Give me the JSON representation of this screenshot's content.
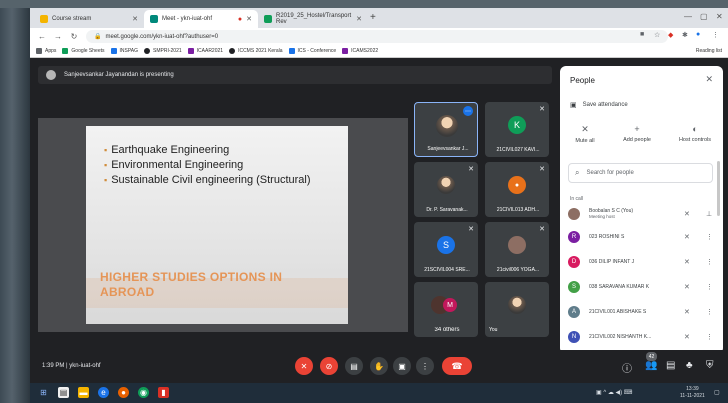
{
  "browser": {
    "tabs": [
      {
        "label": "Course stream",
        "color": "#f4b400"
      },
      {
        "label": "Meet - ykn-iuat-ohf",
        "color": "#00897b"
      },
      {
        "label": "R2019_25_Hostel/Transport Rev",
        "color": "#0f9d58"
      }
    ],
    "url": "meet.google.com/ykn-iuat-ohf?authuser=0",
    "bookmarks": [
      {
        "label": "Apps",
        "color": "#5f6368"
      },
      {
        "label": "Google Sheets",
        "color": "#0f9d58"
      },
      {
        "label": "INSPAG",
        "color": "#1a73e8"
      },
      {
        "label": "SMPRI-2021",
        "color": "#202124"
      },
      {
        "label": "ICAAR2021",
        "color": "#7b1fa2"
      },
      {
        "label": "ICCMS 2021 Kerala",
        "color": "#202124"
      },
      {
        "label": "ICS - Conference",
        "color": "#1a73e8"
      },
      {
        "label": "ICAMS2022",
        "color": "#7b1fa2"
      }
    ],
    "reading_list": "Reading list"
  },
  "meet": {
    "presenting_banner": "Sanjeevsankar Jayanandan is presenting",
    "slide": {
      "bullets": [
        "Earthquake Engineering",
        "Environmental Engineering",
        "Sustainable Civil engineering (Structural)"
      ],
      "title_line1": "HIGHER STUDIES OPTIONS IN",
      "title_line2": "ABROAD"
    },
    "tiles": [
      {
        "name": "Sanjeevsankar J...",
        "avatar": "",
        "color": "#6b6b6b",
        "photo": true
      },
      {
        "name": "21CIVIL027 KAVI...",
        "avatar": "K",
        "color": "#0f9d58",
        "photo": false
      },
      {
        "name": "Dr. P. Saravanak...",
        "avatar": "",
        "color": "#6b6b6b",
        "photo": true
      },
      {
        "name": "21CIVIL013 ADH...",
        "avatar": "",
        "color": "#e8711a",
        "photo": true
      },
      {
        "name": "21SCIVIL004 SRE...",
        "avatar": "S",
        "color": "#1a73e8",
        "photo": false
      },
      {
        "name": "21civil006 YOGA...",
        "avatar": "",
        "color": "#8d6e63",
        "photo": true
      },
      {
        "name": "34 others",
        "avatar": "M",
        "color": "#c2185b",
        "photo": false
      },
      {
        "name": "You",
        "avatar": "",
        "color": "#6b6b6b",
        "photo": true
      }
    ],
    "bottom": {
      "time_and_code": "1:39 PM  |  ykn-iuat-ohf",
      "participant_count": "42"
    }
  },
  "people_panel": {
    "title": "People",
    "save_attendance": "Save attendance",
    "actions": [
      "Mute all",
      "Add people",
      "Host controls"
    ],
    "search_placeholder": "Search for people",
    "section": "In call",
    "participants": [
      {
        "name": "Boobalan S C (You)",
        "sub": "Meeting host",
        "initial": "",
        "color": "#8d6e63"
      },
      {
        "name": "023 ROSHINI S",
        "sub": "",
        "initial": "R",
        "color": "#7b1fa2"
      },
      {
        "name": "036 DILIP INFANT J",
        "sub": "",
        "initial": "D",
        "color": "#d81b60"
      },
      {
        "name": "038 SARAVANA KUMAR K",
        "sub": "",
        "initial": "S",
        "color": "#43a047"
      },
      {
        "name": "21CIVIL001 ABISHAKE S",
        "sub": "",
        "initial": "A",
        "color": "#607d8b"
      },
      {
        "name": "21CIVIL002 NISHANTH K...",
        "sub": "",
        "initial": "N",
        "color": "#3f51b5"
      }
    ]
  },
  "taskbar": {
    "clock_time": "13:39",
    "clock_date": "11-11-2021"
  }
}
